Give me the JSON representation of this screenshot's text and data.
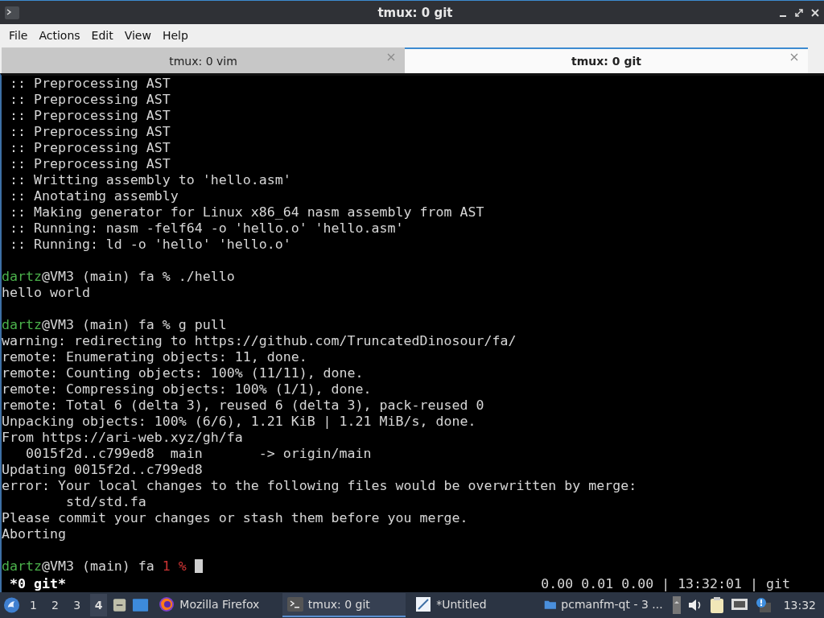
{
  "window": {
    "title": "tmux: 0 git"
  },
  "menu": [
    "File",
    "Actions",
    "Edit",
    "View",
    "Help"
  ],
  "tabs": [
    {
      "label": "tmux: 0 vim",
      "selected": false
    },
    {
      "label": "tmux: 0 git",
      "selected": true
    }
  ],
  "terminal": {
    "lines": [
      {
        "kind": "output",
        "text": " :: Preprocessing AST"
      },
      {
        "kind": "output",
        "text": " :: Preprocessing AST"
      },
      {
        "kind": "output",
        "text": " :: Preprocessing AST"
      },
      {
        "kind": "output",
        "text": " :: Preprocessing AST"
      },
      {
        "kind": "output",
        "text": " :: Preprocessing AST"
      },
      {
        "kind": "output",
        "text": " :: Preprocessing AST"
      },
      {
        "kind": "output",
        "text": " :: Writting assembly to 'hello.asm'"
      },
      {
        "kind": "output",
        "text": " :: Anotating assembly"
      },
      {
        "kind": "output",
        "text": " :: Making generator for Linux x86_64 nasm assembly from AST"
      },
      {
        "kind": "output",
        "text": " :: Running: nasm -felf64 -o 'hello.o' 'hello.asm'"
      },
      {
        "kind": "output",
        "text": " :: Running: ld -o 'hello' 'hello.o'"
      },
      {
        "kind": "blank"
      },
      {
        "kind": "prompt",
        "user": "dartz",
        "host": "@VM3 (main) fa",
        "symbol": "%",
        "command": "./hello"
      },
      {
        "kind": "output",
        "text": "hello world"
      },
      {
        "kind": "blank"
      },
      {
        "kind": "prompt",
        "user": "dartz",
        "host": "@VM3 (main) fa",
        "symbol": "%",
        "command": "g pull"
      },
      {
        "kind": "output",
        "text": "warning: redirecting to https://github.com/TruncatedDinosour/fa/"
      },
      {
        "kind": "output",
        "text": "remote: Enumerating objects: 11, done."
      },
      {
        "kind": "output",
        "text": "remote: Counting objects: 100% (11/11), done."
      },
      {
        "kind": "output",
        "text": "remote: Compressing objects: 100% (1/1), done."
      },
      {
        "kind": "output",
        "text": "remote: Total 6 (delta 3), reused 6 (delta 3), pack-reused 0"
      },
      {
        "kind": "output",
        "text": "Unpacking objects: 100% (6/6), 1.21 KiB | 1.21 MiB/s, done."
      },
      {
        "kind": "output",
        "text": "From https://ari-web.xyz/gh/fa"
      },
      {
        "kind": "output",
        "text": "   0015f2d..c799ed8  main       -> origin/main"
      },
      {
        "kind": "output",
        "text": "Updating 0015f2d..c799ed8"
      },
      {
        "kind": "output",
        "text": "error: Your local changes to the following files would be overwritten by merge:"
      },
      {
        "kind": "output",
        "text": "        std/std.fa"
      },
      {
        "kind": "output",
        "text": "Please commit your changes or stash them before you merge."
      },
      {
        "kind": "output",
        "text": "Aborting"
      },
      {
        "kind": "blank"
      },
      {
        "kind": "prompt",
        "user": "dartz",
        "host": "@VM3 (main) fa",
        "status": "1",
        "symbol": "%",
        "cursor": true
      }
    ],
    "status_bar": {
      "session": " *0 git*",
      "info": "0.00 0.01 0.00 | 13:32:01 | git"
    }
  },
  "taskbar": {
    "desktops": [
      {
        "label": "1",
        "selected": false
      },
      {
        "label": "2",
        "selected": false
      },
      {
        "label": "3",
        "selected": false
      },
      {
        "label": "4",
        "selected": true
      }
    ],
    "tasks": [
      {
        "label": "Mozilla Firefox",
        "kind": "browser",
        "selected": false
      },
      {
        "label": "tmux: 0 git",
        "kind": "terminal",
        "selected": true
      },
      {
        "label": "*Untitled",
        "kind": "editor",
        "selected": false
      },
      {
        "label": "pcmanfm-qt - 3 ...",
        "kind": "folder",
        "selected": false
      }
    ],
    "clock": "13:32"
  }
}
